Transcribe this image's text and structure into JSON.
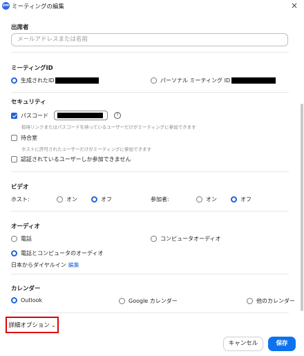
{
  "window": {
    "app_icon_text": "zm",
    "title": "ミーティングの編集",
    "close_glyph": "×"
  },
  "attendees": {
    "title": "出席者",
    "placeholder": "メールアドレスまたは名前"
  },
  "meeting_id": {
    "title": "ミーティングID",
    "generated_label": "生成されたID",
    "personal_label": "パーソナル ミーティング ID",
    "selected": "generated"
  },
  "security": {
    "title": "セキュリティ",
    "passcode_label": "パスコード",
    "passcode_checked": true,
    "help_glyph": "?",
    "passcode_hint": "招待リンクまたはパスコードを持っているユーザーだけがミーティングに参加できます",
    "waiting_room_label": "待合室",
    "waiting_room_checked": false,
    "waiting_room_hint": "ホストに許可されたユーザーだけがミーティングに参加できます",
    "auth_label": "認証されているユーザーしか参加できません",
    "auth_checked": false
  },
  "video": {
    "title": "ビデオ",
    "host_label": "ホスト:",
    "participant_label": "参加者:",
    "on_label": "オン",
    "off_label": "オフ",
    "host_value": "off",
    "participant_value": "off"
  },
  "audio": {
    "title": "オーディオ",
    "phone_label": "電話",
    "computer_label": "コンピュータオーディオ",
    "both_label": "電話とコンピュータのオーディオ",
    "selected": "both",
    "dial_in_text": "日本からダイヤルイン",
    "edit_link": "編集"
  },
  "calendar": {
    "title": "カレンダー",
    "outlook_label": "Outlook",
    "google_label": "Google カレンダー",
    "other_label": "他のカレンダー",
    "selected": "outlook"
  },
  "advanced": {
    "label": "詳細オプション",
    "chevron": "⌄"
  },
  "buttons": {
    "cancel": "キャンセル",
    "save": "保存"
  },
  "colors": {
    "accent": "#0e72ed",
    "highlight_border": "#e00000"
  }
}
